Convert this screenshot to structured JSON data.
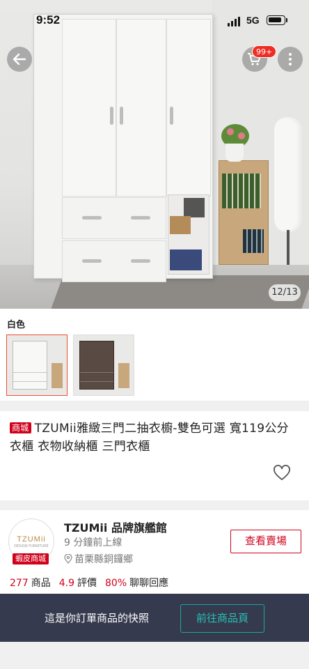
{
  "status_bar": {
    "time": "9:52",
    "network": "5G"
  },
  "header": {
    "back_icon": "arrow-left-icon",
    "cart_icon": "cart-icon",
    "cart_badge": "99+",
    "more_icon": "more-vertical-icon"
  },
  "gallery": {
    "counter": "12/13"
  },
  "variation": {
    "selected_label": "白色",
    "options": [
      "white-wardrobe-thumb",
      "dark-wardrobe-thumb"
    ]
  },
  "product": {
    "mall_badge": "商城",
    "title": "TZUMii雅緻三門二抽衣櫥-雙色可選  寬119公分 衣櫃 衣物收納櫃  三門衣櫃"
  },
  "shop": {
    "logo_text": "TZUMii",
    "logo_subtext": "DESIGN FURNITURE",
    "mall_tag": "蝦皮商城",
    "name": "TZUMii 品牌旗艦館",
    "online": "9 分鐘前上線",
    "location": "苗栗縣銅鑼鄉",
    "view_button": "查看賣場",
    "stats": {
      "products_num": "277",
      "products_label": "商品",
      "rating_num": "4.9",
      "rating_label": "評價",
      "chat_num": "80%",
      "chat_label": "聊聊回應"
    }
  },
  "snapshot": {
    "text": "這是你訂單商品的快照",
    "button": "前往商品頁"
  },
  "colors": {
    "accent_red": "#d0011b",
    "badge_red": "#ee2d24",
    "bar_bg": "#363a4e",
    "teal": "#26c2b3"
  }
}
